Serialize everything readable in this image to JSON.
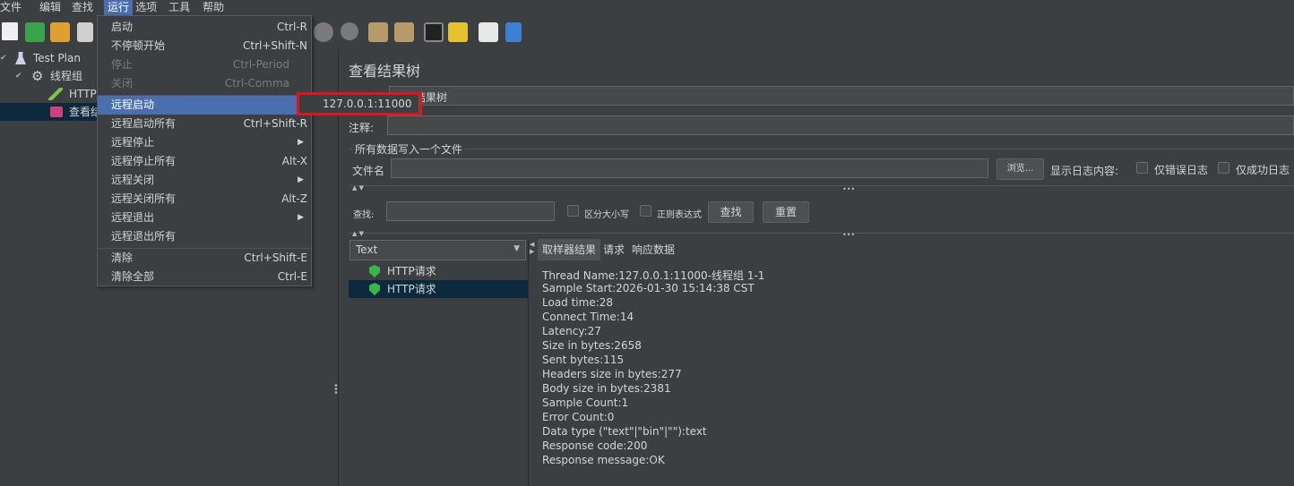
{
  "menubar": [
    "文件",
    "编辑",
    "查找",
    "运行",
    "选项",
    "工具",
    "帮助"
  ],
  "tree": {
    "items": [
      {
        "label": "Test Plan"
      },
      {
        "label": "线程组"
      },
      {
        "label": "HTTP请"
      },
      {
        "label": "查看结"
      }
    ]
  },
  "run_menu": {
    "items": [
      {
        "label": "启动",
        "shortcut": "Ctrl-R"
      },
      {
        "label": "不停顿开始",
        "shortcut": "Ctrl+Shift-N"
      },
      {
        "label": "停止",
        "shortcut": "Ctrl-Period"
      },
      {
        "label": "关闭",
        "shortcut": "Ctrl-Comma"
      },
      {
        "label": "远程启动",
        "shortcut": ""
      },
      {
        "label": "远程启动所有",
        "shortcut": "Ctrl+Shift-R"
      },
      {
        "label": "远程停止",
        "shortcut": ""
      },
      {
        "label": "远程停止所有",
        "shortcut": "Alt-X"
      },
      {
        "label": "远程关闭",
        "shortcut": ""
      },
      {
        "label": "远程关闭所有",
        "shortcut": "Alt-Z"
      },
      {
        "label": "远程退出",
        "shortcut": ""
      },
      {
        "label": "远程退出所有",
        "shortcut": ""
      },
      {
        "label": "清除",
        "shortcut": "Ctrl+Shift-E"
      },
      {
        "label": "清除全部",
        "shortcut": "Ctrl-E"
      }
    ]
  },
  "submenu": {
    "item": "127.0.0.1:11000"
  },
  "panel": {
    "title": "查看结果树",
    "name_value": "看结果树",
    "comment_label": "注释:",
    "file_group_label": "所有数据写入一个文件",
    "filename_label": "文件名",
    "browse_button": "浏览...",
    "log_content_label": "显示日志内容:",
    "errors_only_label": "仅错误日志",
    "success_only_label": "仅成功日志",
    "search_label": "查找:",
    "case_sensitive_label": "区分大小写",
    "regex_label": "正则表达式",
    "find_button": "查找",
    "reset_button": "重置",
    "renderer_select": "Text"
  },
  "results": [
    {
      "label": "HTTP请求"
    },
    {
      "label": "HTTP请求"
    }
  ],
  "tabs": [
    "取样器结果",
    "请求",
    "响应数据"
  ],
  "sample_result": [
    "Thread Name:127.0.0.1:11000-线程组 1-1",
    "Sample Start:2026-01-30 15:14:38 CST",
    "Load time:28",
    "Connect Time:14",
    "Latency:27",
    "Size in bytes:2658",
    "Sent bytes:115",
    "Headers size in bytes:277",
    "Body size in bytes:2381",
    "Sample Count:1",
    "Error Count:0",
    "Data type (\"text\"|\"bin\"|\"\"):text",
    "Response code:200",
    "Response message:OK"
  ],
  "colors": {
    "background": "#3c3f41",
    "selection": "#4b6eaf",
    "highlight_box": "#e1141e",
    "success_icon": "#3ab54a"
  }
}
